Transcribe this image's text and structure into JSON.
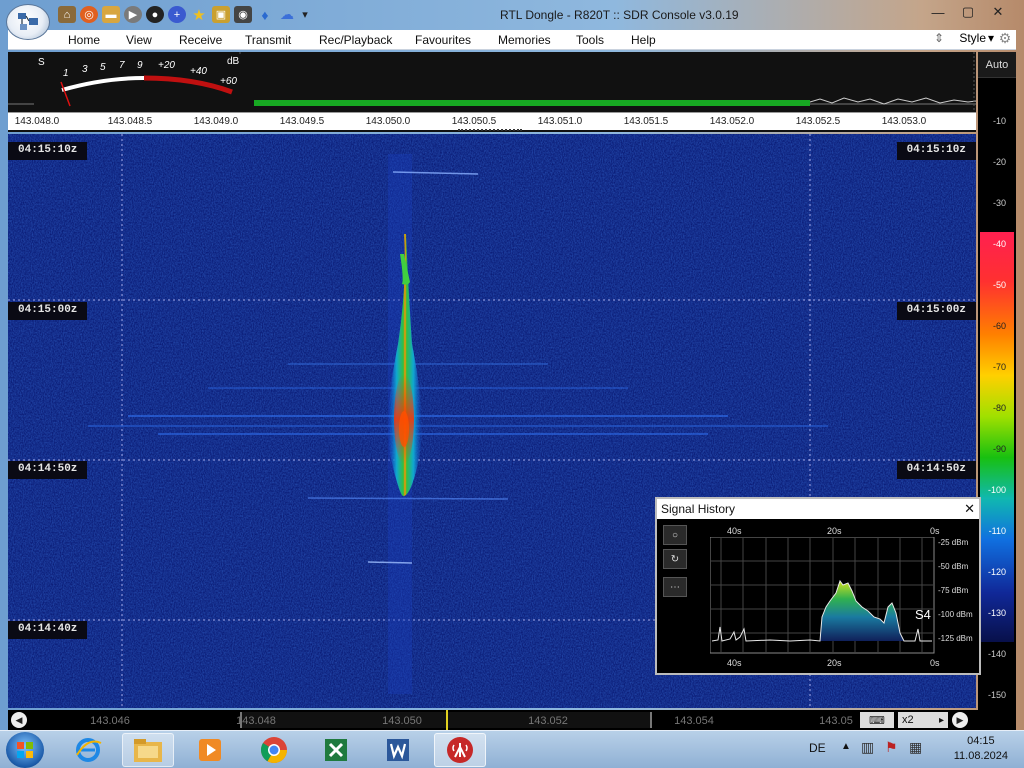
{
  "window": {
    "title": "RTL Dongle - R820T :: SDR Console v3.0.19",
    "minimize": "—",
    "maximize": "▢",
    "close": "✕"
  },
  "quick_access": [
    "home-icon",
    "lifebuoy-icon",
    "folder-icon",
    "play-icon",
    "record-icon",
    "plus-icon",
    "star-icon",
    "lock-icon",
    "camera-icon",
    "drop-icon",
    "cloud-icon",
    "dropdown-icon"
  ],
  "menu": {
    "items": [
      "Home",
      "View",
      "Receive",
      "Transmit",
      "Rec/Playback",
      "Favourites",
      "Memories",
      "Tools",
      "Help"
    ],
    "style_label": "Style",
    "style_arrow": "▾"
  },
  "smeter": {
    "s_label": "S",
    "s_ticks": [
      "1",
      "3",
      "5",
      "7",
      "9"
    ],
    "db_ticks": [
      "+20",
      "+40",
      "+60"
    ],
    "db_label": "dB"
  },
  "frequency_axis": {
    "labels": [
      "143.048.0",
      "143.048.5",
      "143.049.0",
      "143.049.5",
      "143.050.0",
      "143.050.5",
      "143.051.0",
      "143.051.5",
      "143.052.0",
      "143.052.5",
      "143.053.0"
    ]
  },
  "waterfall": {
    "timestamps": [
      "04:15:10z",
      "04:15:00z",
      "04:14:50z",
      "04:14:40z"
    ]
  },
  "scale": {
    "auto_label": "Auto",
    "levels": [
      "-10",
      "-20",
      "-30",
      "-40",
      "-50",
      "-60",
      "-70",
      "-80",
      "-90",
      "-100",
      "-110",
      "-120",
      "-130",
      "-140",
      "-150"
    ]
  },
  "signal_history": {
    "title": "Signal History",
    "close": "✕",
    "buttons": [
      "○",
      "↻",
      "⋯"
    ],
    "x_top": [
      "40s",
      "20s",
      "0s"
    ],
    "x_bottom": [
      "40s",
      "20s",
      "0s"
    ],
    "y_labels": [
      "-25 dBm",
      "-50 dBm",
      "-75 dBm",
      "-100 dBm",
      "-125 dBm"
    ],
    "s_value": "S4"
  },
  "bottom_bar": {
    "labels": [
      "143.046",
      "143.048",
      "143.050",
      "143.052",
      "143.054",
      "143.05"
    ],
    "zoom": "x2",
    "zoom_arrow": "▸"
  },
  "taskbar": {
    "language": "DE",
    "time": "04:15",
    "date": "11.08.2024"
  },
  "colors": {
    "waterfall_bg": "#0a1a6e",
    "signal_hot": "#ff4000",
    "signal_mid": "#20c040",
    "spectrum_green": "#17a822"
  }
}
